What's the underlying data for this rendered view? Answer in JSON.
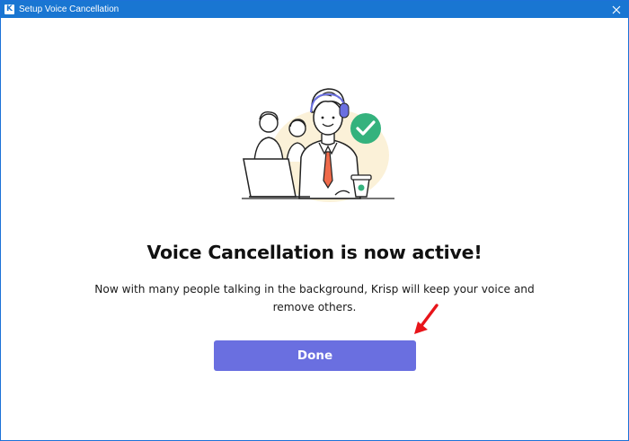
{
  "window": {
    "title": "Setup Voice Cancellation",
    "app_icon": "krisp-logo-icon",
    "close_icon": "close-icon"
  },
  "main": {
    "illustration": "person-with-headset-checkmark-illustration",
    "headline": "Voice Cancellation is now active!",
    "description": "Now with many people talking in the background, Krisp will keep your voice and remove others.",
    "done_label": "Done"
  },
  "annotation": {
    "arrow_icon": "red-arrow-icon",
    "color": "#e8141a"
  },
  "colors": {
    "titlebar": "#1976d2",
    "button": "#6a6fe0",
    "check": "#34b27d",
    "headset": "#6a6fe0",
    "tie": "#ef6a4a"
  }
}
